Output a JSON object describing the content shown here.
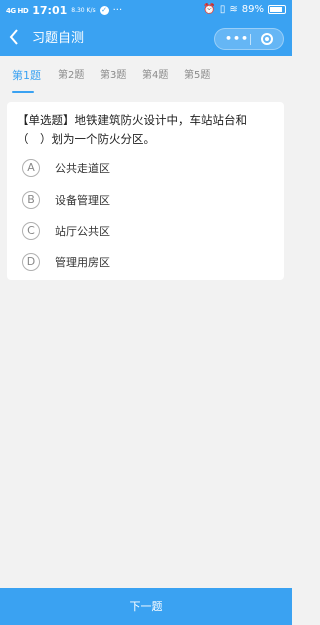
{
  "status_bar": {
    "signal": "4G HD",
    "time": "17:01",
    "net_speed": "8.30 K/s",
    "more": "···",
    "battery": "89%",
    "battery_level": 0.89
  },
  "nav": {
    "back_icon": "chevron-left-icon",
    "title": "习题自测",
    "more_icon": "more-dots-icon",
    "close_icon": "target-icon"
  },
  "tabs": [
    {
      "label": "第1题",
      "active": true
    },
    {
      "label": "第2题",
      "active": false
    },
    {
      "label": "第3题",
      "active": false
    },
    {
      "label": "第4题",
      "active": false
    },
    {
      "label": "第5题",
      "active": false
    }
  ],
  "question": {
    "text": "【单选题】地铁建筑防火设计中，车站站台和（　）划为一个防火分区。"
  },
  "options": [
    {
      "letter": "A",
      "text": "公共走道区"
    },
    {
      "letter": "B",
      "text": "设备管理区"
    },
    {
      "letter": "C",
      "text": "站厅公共区"
    },
    {
      "letter": "D",
      "text": "管理用房区"
    }
  ],
  "footer": {
    "next_label": "下一题"
  },
  "colors": {
    "accent": "#3aa2f2"
  }
}
